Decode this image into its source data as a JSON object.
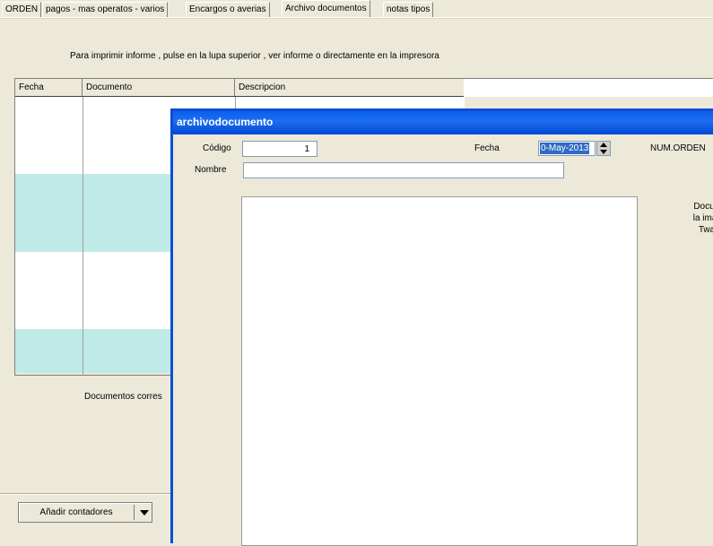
{
  "tabs": [
    {
      "label": "ORDEN"
    },
    {
      "label": "pagos - mas operatos - varios"
    },
    {
      "label": "Encargos o averias"
    },
    {
      "label": "Archivo documentos"
    },
    {
      "label": "notas tipos"
    }
  ],
  "instructions": "Para imprimir informe , pulse en la lupa superior , ver informe o directamente en la impresora",
  "grid": {
    "columns": [
      "Fecha",
      "Documento",
      "Descripcion"
    ]
  },
  "docs_label": "Documentos corres",
  "add_button": {
    "label": "Añadir contadores"
  },
  "dialog": {
    "title": "archivodocumento",
    "codigo_label": "Código",
    "codigo_value": "1",
    "fecha_label": "Fecha",
    "fecha_value": "0-May-2013",
    "num_orden_label": "NUM.ORDEN",
    "nombre_label": "Nombre",
    "nombre_value": "",
    "side_text": [
      "Docum",
      "la imag",
      "Twain"
    ]
  },
  "colors": {
    "row_cyan": "#BFEAE7",
    "titlebar_blue": "#0A5FEA",
    "selection_blue": "#316AC5"
  }
}
